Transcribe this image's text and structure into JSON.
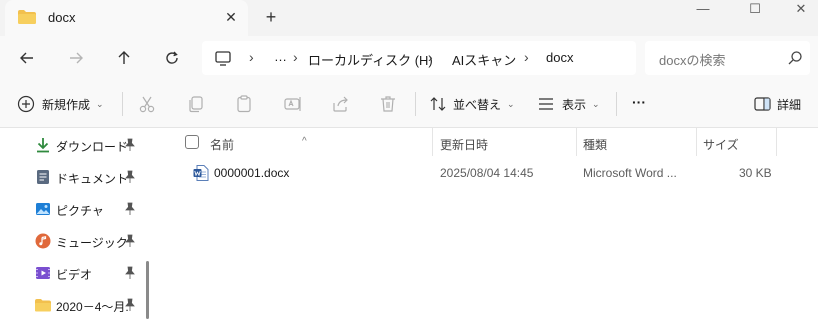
{
  "window": {
    "tab_title": "docx",
    "tab_close": "✕",
    "new_tab": "+",
    "controls": {
      "minimize": "—",
      "maximize": "☐",
      "close": "✕"
    }
  },
  "address": {
    "breadcrumb": [
      "ローカルディスク (H)",
      "AIスキャン",
      "docx"
    ],
    "overflow": "…",
    "search_placeholder": "docxの検索"
  },
  "toolbar": {
    "new_label": "新規作成",
    "sort_label": "並べ替え",
    "view_label": "表示",
    "more_label": "···",
    "details_label": "詳細"
  },
  "sidebar": {
    "items": [
      {
        "label": "ダウンロード",
        "icon": "download-icon",
        "color": "#2f8a3e"
      },
      {
        "label": "ドキュメント",
        "icon": "documents-icon",
        "color": "#5a6a80"
      },
      {
        "label": "ピクチャ",
        "icon": "pictures-icon",
        "color": "#1e7fd6"
      },
      {
        "label": "ミュージック",
        "icon": "music-icon",
        "color": "#e0693b"
      },
      {
        "label": "ビデオ",
        "icon": "videos-icon",
        "color": "#7a4fd0"
      },
      {
        "label": "2020－4～月.",
        "icon": "folder-icon",
        "color": "#f2c04e"
      }
    ]
  },
  "columns": {
    "name": "名前",
    "modified": "更新日時",
    "type": "種類",
    "size": "サイズ"
  },
  "files": [
    {
      "name": "0000001.docx",
      "modified": "2025/08/04 14:45",
      "type": "Microsoft Word ...",
      "size": "30 KB"
    }
  ],
  "colors": {
    "accent": "#1e5fbf",
    "folder": "#f2c04e",
    "word": "#2b579a"
  }
}
